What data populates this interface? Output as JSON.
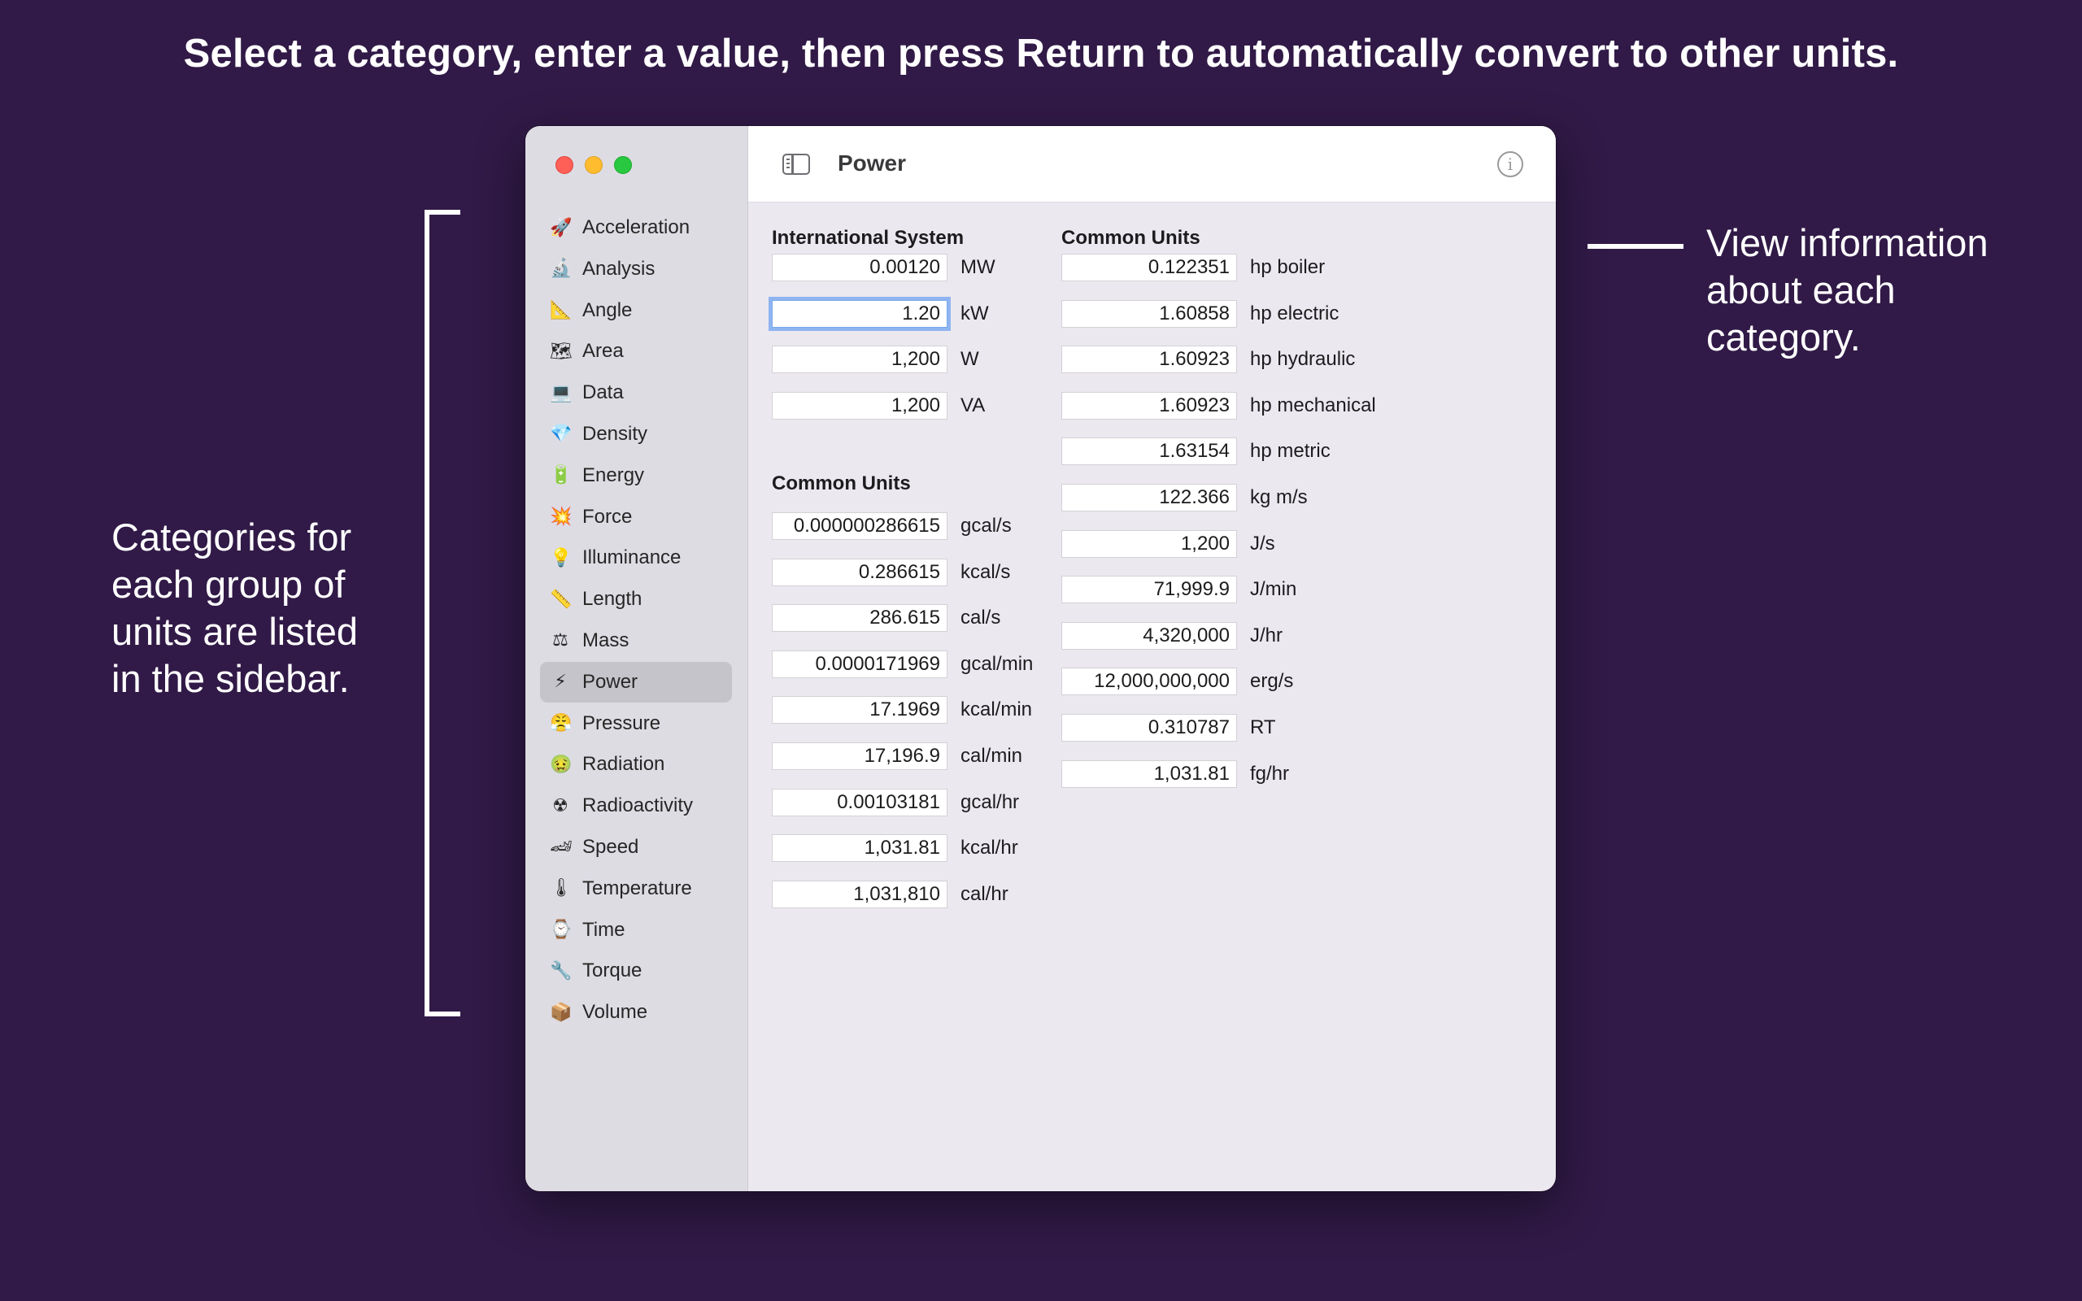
{
  "headline": "Select a category, enter a value, then press Return to automatically convert to other units.",
  "callouts": {
    "left": "Categories for each group of units are listed in the sidebar.",
    "right": "View information about each category."
  },
  "window": {
    "title": "Power",
    "info_glyph": "i"
  },
  "sidebar": {
    "items": [
      {
        "label": "Acceleration",
        "icon": "🚀",
        "icon_name": "rocket-icon"
      },
      {
        "label": "Analysis",
        "icon": "🔬",
        "icon_name": "microscope-icon"
      },
      {
        "label": "Angle",
        "icon": "📐",
        "icon_name": "triangle-ruler-icon"
      },
      {
        "label": "Area",
        "icon": "🗺",
        "icon_name": "map-icon"
      },
      {
        "label": "Data",
        "icon": "💻",
        "icon_name": "laptop-icon"
      },
      {
        "label": "Density",
        "icon": "💎",
        "icon_name": "gem-icon"
      },
      {
        "label": "Energy",
        "icon": "🔋",
        "icon_name": "battery-icon"
      },
      {
        "label": "Force",
        "icon": "💥",
        "icon_name": "collision-icon"
      },
      {
        "label": "Illuminance",
        "icon": "💡",
        "icon_name": "light-bulb-icon"
      },
      {
        "label": "Length",
        "icon": "📏",
        "icon_name": "ruler-icon"
      },
      {
        "label": "Mass",
        "icon": "⚖",
        "icon_name": "scales-icon"
      },
      {
        "label": "Power",
        "icon": "⚡",
        "icon_name": "lightning-icon",
        "selected": true
      },
      {
        "label": "Pressure",
        "icon": "😤",
        "icon_name": "huffing-face-icon"
      },
      {
        "label": "Radiation",
        "icon": "🤢",
        "icon_name": "nauseated-face-icon"
      },
      {
        "label": "Radioactivity",
        "icon": "☢",
        "icon_name": "radioactive-icon"
      },
      {
        "label": "Speed",
        "icon": "🏎",
        "icon_name": "race-car-icon"
      },
      {
        "label": "Temperature",
        "icon": "🌡",
        "icon_name": "thermometer-icon"
      },
      {
        "label": "Time",
        "icon": "⌚",
        "icon_name": "watch-icon"
      },
      {
        "label": "Torque",
        "icon": "🔧",
        "icon_name": "wrench-icon"
      },
      {
        "label": "Volume",
        "icon": "📦",
        "icon_name": "package-icon"
      }
    ]
  },
  "international_system": {
    "title": "International System",
    "rows": [
      {
        "value": "0.00120",
        "unit": "MW"
      },
      {
        "value": "1.20",
        "unit": "kW"
      },
      {
        "value": "1,200",
        "unit": "W"
      },
      {
        "value": "1,200",
        "unit": "VA"
      }
    ]
  },
  "common_units_left": {
    "title": "Common Units",
    "rows": [
      {
        "value": "0.000000286615",
        "unit": "gcal/s"
      },
      {
        "value": "0.286615",
        "unit": "kcal/s"
      },
      {
        "value": "286.615",
        "unit": "cal/s"
      },
      {
        "value": "0.0000171969",
        "unit": "gcal/min"
      },
      {
        "value": "17.1969",
        "unit": "kcal/min"
      },
      {
        "value": "17,196.9",
        "unit": "cal/min"
      },
      {
        "value": "0.00103181",
        "unit": "gcal/hr"
      },
      {
        "value": "1,031.81",
        "unit": "kcal/hr"
      },
      {
        "value": "1,031,810",
        "unit": "cal/hr"
      }
    ]
  },
  "common_units_right": {
    "title": "Common Units",
    "rows": [
      {
        "value": "0.122351",
        "unit": "hp boiler"
      },
      {
        "value": "1.60858",
        "unit": "hp electric"
      },
      {
        "value": "1.60923",
        "unit": "hp hydraulic"
      },
      {
        "value": "1.60923",
        "unit": "hp mechanical"
      },
      {
        "value": "1.63154",
        "unit": "hp metric"
      },
      {
        "value": "122.366",
        "unit": "kg m/s"
      },
      {
        "value": "1,200",
        "unit": "J/s"
      },
      {
        "value": "71,999.9",
        "unit": "J/min"
      },
      {
        "value": "4,320,000",
        "unit": "J/hr"
      },
      {
        "value": "12,000,000,000",
        "unit": "erg/s"
      },
      {
        "value": "0.310787",
        "unit": "RT"
      },
      {
        "value": "1,031.81",
        "unit": "fg/hr"
      }
    ]
  }
}
